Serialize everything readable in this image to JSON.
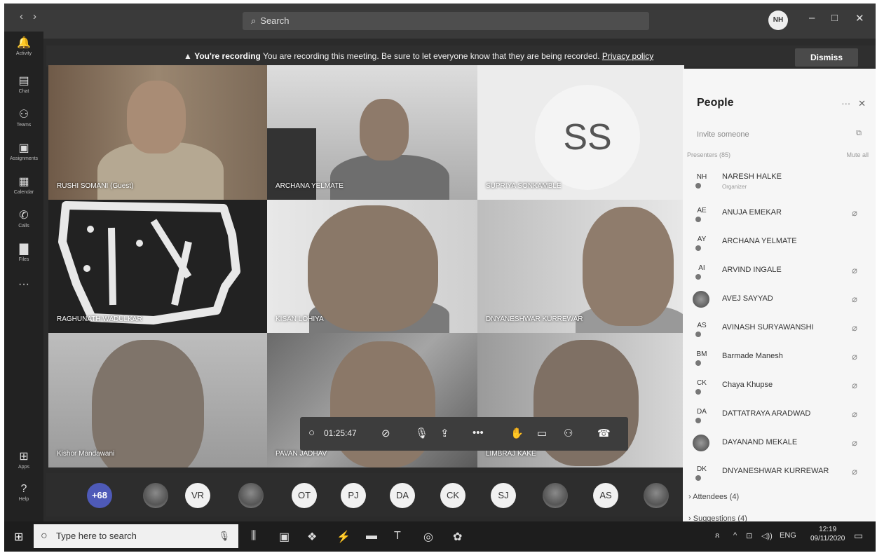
{
  "titlebar": {
    "search_placeholder": "Search",
    "user_initials": "NH"
  },
  "banner": {
    "title": "You're recording",
    "message": "You are recording this meeting. Be sure to let everyone know that they are being recorded.",
    "link": "Privacy policy",
    "dismiss": "Dismiss"
  },
  "rail": {
    "activity": "Activity",
    "chat": "Chat",
    "teams": "Teams",
    "assignments": "Assignments",
    "calendar": "Calendar",
    "calls": "Calls",
    "files": "Files",
    "apps": "Apps",
    "help": "Help"
  },
  "videos": {
    "t1": "RUSHI SOMANI (Guest)",
    "t2": "ARCHANA YELMATE",
    "t3": "SUPRIYA SONKAMBLE",
    "t3_initials": "SS",
    "t4": "RAGHUNATH WADULKAR",
    "t5": "KISAN LOHIYA",
    "t6": "DNYANESHWAR KURREWAR",
    "t7": "Kishor Mandawani",
    "t8": "PAVAN JADHAV",
    "t9": "LIMBRAJ KAKE"
  },
  "controls": {
    "timer": "01:25:47"
  },
  "strip": {
    "more": "+68",
    "a1": "VR",
    "a2": "OT",
    "a3": "PJ",
    "a4": "DA",
    "a5": "CK",
    "a6": "SJ",
    "a7": "AS"
  },
  "people": {
    "title": "People",
    "invite": "Invite someone",
    "presenters": "Presenters (85)",
    "mute_all": "Mute all",
    "list": [
      {
        "initials": "NH",
        "name": "NARESH HALKE",
        "role": "Organizer"
      },
      {
        "initials": "AE",
        "name": "ANUJA EMEKAR"
      },
      {
        "initials": "AY",
        "name": "ARCHANA YELMATE"
      },
      {
        "initials": "AI",
        "name": "ARVIND INGALE"
      },
      {
        "initials": "",
        "name": "AVEJ SAYYAD"
      },
      {
        "initials": "AS",
        "name": "AVINASH SURYAWANSHI"
      },
      {
        "initials": "BM",
        "name": "Barmade Manesh"
      },
      {
        "initials": "CK",
        "name": "Chaya Khupse"
      },
      {
        "initials": "DA",
        "name": "DATTATRAYA ARADWAD"
      },
      {
        "initials": "",
        "name": "DAYANAND MEKALE"
      },
      {
        "initials": "DK",
        "name": "DNYANESHWAR KURREWAR"
      }
    ],
    "attendees": "Attendees (4)",
    "suggestions": "Suggestions (4)"
  },
  "taskbar": {
    "search": "Type here to search",
    "lang": "ENG",
    "time": "12:19",
    "date": "09/11/2020"
  }
}
